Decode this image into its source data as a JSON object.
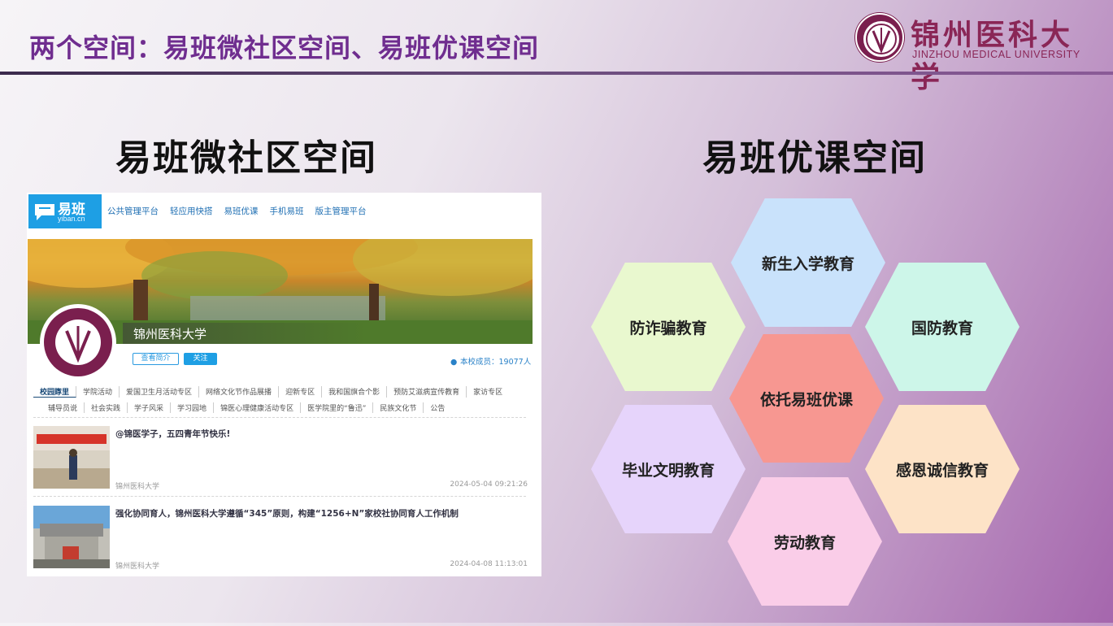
{
  "slide": {
    "title": "两个空间：易班微社区空间、易班优课空间"
  },
  "logo": {
    "cn": "锦州医科大学",
    "en": "JINZHOU MEDICAL UNIVERSITY",
    "color": "#8a2656"
  },
  "left_heading": "易班微社区空间",
  "right_heading": "易班优课空间",
  "web": {
    "logo_cn": "易班",
    "logo_en": "yiban.cn",
    "nav": [
      "公共管理平台",
      "轻应用快搭",
      "易班优课",
      "手机易班",
      "版主管理平台"
    ],
    "school_name": "锦州医科大学",
    "btn_intro": "查看简介",
    "btn_follow": "关注",
    "members": "本校成员：19077人",
    "tabs_row1": [
      "校园賯里",
      "学院活动",
      "爱国卫生月活动专区",
      "网络文化节作品展播",
      "迎新专区",
      "我和国旗合个影",
      "预防艾滋病宣传教育",
      "家访专区"
    ],
    "tabs_row2": [
      "辅导员说",
      "社会实践",
      "学子风采",
      "学习园地",
      "锦医心理健康活动专区",
      "医学院里的“鲁迅”",
      "民族文化节",
      "公告"
    ],
    "posts": [
      {
        "title": "@锦医学子，五四青年节快乐!",
        "source": "锦州医科大学",
        "time": "2024-05-04 09:21:26"
      },
      {
        "title": "强化协同育人，锦州医科大学遵循“345”原则，构建“1256+N”家校社协同育人工作机制",
        "source": "锦州医科大学",
        "time": "2024-04-08 11:13:01"
      }
    ]
  },
  "hexagons": {
    "freshman": "新生入学教育",
    "antifraud": "防诈骗教育",
    "defense": "国防教育",
    "center": "依托易班优课",
    "graduation": "毕业文明教育",
    "gratitude": "感恩诚信教育",
    "labor": "劳动教育"
  },
  "colors": {
    "title": "#6f2d8f",
    "yiban_blue": "#1e9fe4",
    "hex_center": "#f79791"
  }
}
